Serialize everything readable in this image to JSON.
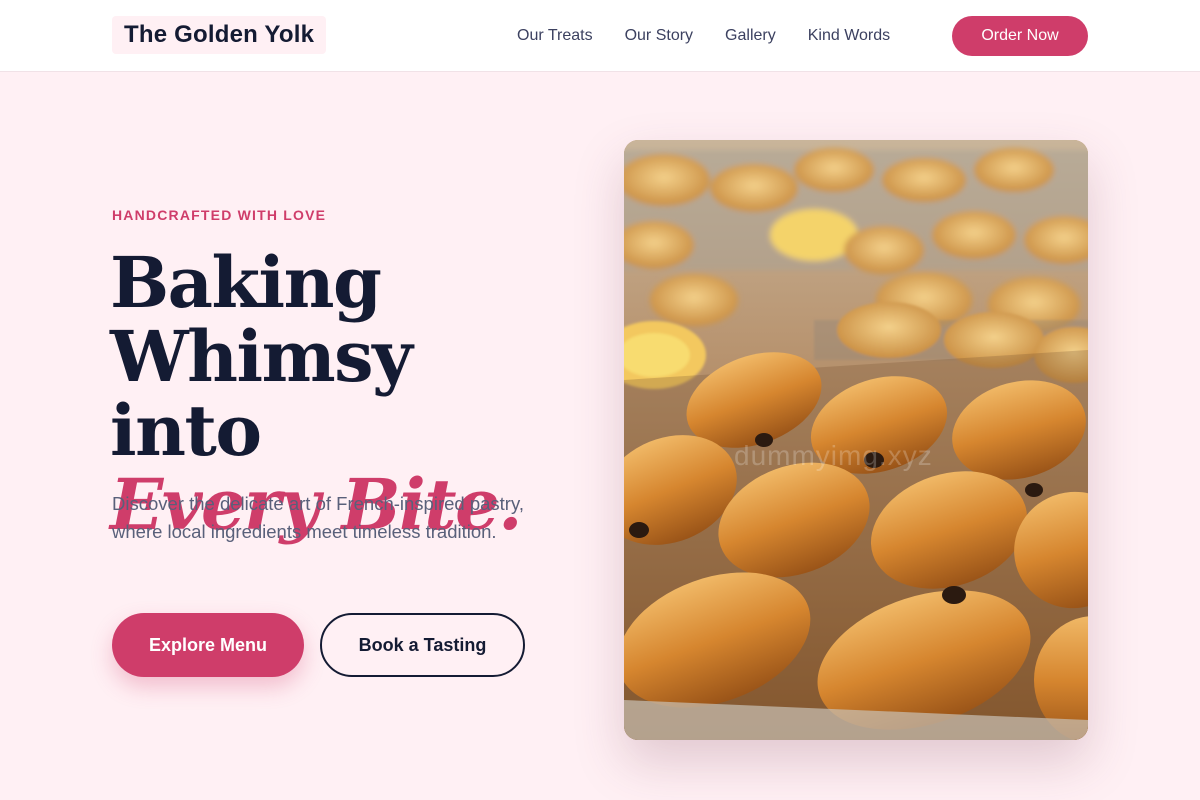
{
  "brand": {
    "name": "The Golden Yolk"
  },
  "nav": {
    "items": [
      {
        "label": "Our Treats"
      },
      {
        "label": "Our Story"
      },
      {
        "label": "Gallery"
      },
      {
        "label": "Kind Words"
      }
    ],
    "cta_label": "Order Now"
  },
  "hero": {
    "eyebrow": "HANDCRAFTED WITH LOVE",
    "headline_line1": "Baking",
    "headline_line2": "Whimsy into",
    "headline_accent": "Every Bite.",
    "lead": "Discover the delicate art of French-inspired pastry, where local ingredients meet timeless tradition.",
    "primary_button": "Explore Menu",
    "secondary_button": "Book a Tasting",
    "image_watermark": "dummyimg.xyz"
  },
  "colors": {
    "accent": "#cf3d6a",
    "ink": "#141b33",
    "page_bg": "#fff0f4",
    "muted_text": "#59607a"
  }
}
